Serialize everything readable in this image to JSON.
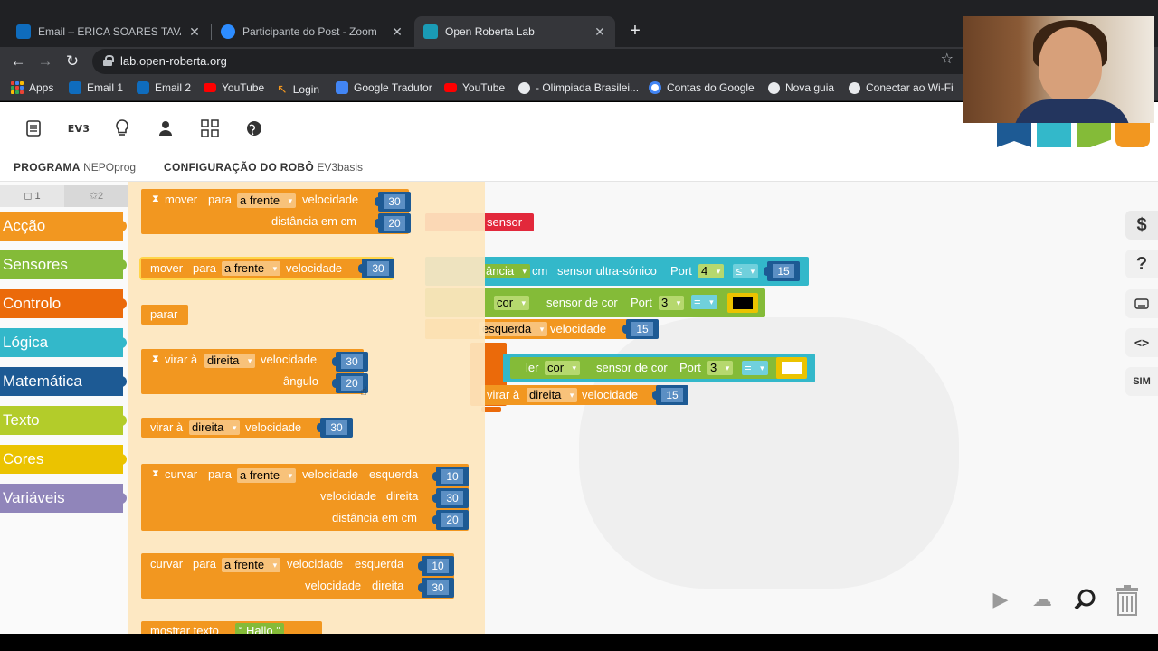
{
  "browser": {
    "tabs": [
      {
        "label": "Email – ERICA SOARES TAVARES",
        "favicon": "outlook-icon",
        "color": "#0f6cbd",
        "active": false
      },
      {
        "label": "Participante do Post - Zoom",
        "favicon": "zoom-icon",
        "color": "#2d8cff",
        "active": false
      },
      {
        "label": "Open Roberta Lab",
        "favicon": "roberta-icon",
        "color": "#1a9bb5",
        "active": true
      }
    ],
    "url": "lab.open-roberta.org",
    "bookmarks": [
      {
        "label": "Apps",
        "icon": "apps-grid-icon"
      },
      {
        "label": "Email 1",
        "icon": "outlook-icon"
      },
      {
        "label": "Email 2",
        "icon": "outlook-icon"
      },
      {
        "label": "YouTube",
        "icon": "youtube-icon"
      },
      {
        "label": "Login",
        "icon": "login-icon"
      },
      {
        "label": "Google Tradutor",
        "icon": "translate-icon"
      },
      {
        "label": "YouTube",
        "icon": "youtube-icon"
      },
      {
        "label": "- Olimpiada Brasilei...",
        "icon": "globe-icon"
      },
      {
        "label": "Contas do Google",
        "icon": "google-icon"
      },
      {
        "label": "Nova guia",
        "icon": "globe-icon"
      },
      {
        "label": "Conectar ao Wi-Fi",
        "icon": "globe-icon"
      }
    ]
  },
  "app": {
    "menu": {
      "ev3_label": "EV3",
      "icons": [
        "document-icon",
        "ev3-robot-icon",
        "lightbulb-icon",
        "user-icon",
        "gallery-icon",
        "globe-icon"
      ],
      "logo_colors": [
        "#1d5a94",
        "#33b8ca",
        "#84bb38",
        "#f29720"
      ]
    },
    "tabs": {
      "program_label": "PROGRAMA",
      "program_name": "NEPOprog",
      "config_label": "CONFIGURAÇÃO DO ROBÔ",
      "config_name": "EV3basis"
    },
    "levels": {
      "beginner": "1",
      "expert": "2"
    },
    "categories": [
      {
        "label": "Acção",
        "color": "#f29720"
      },
      {
        "label": "Sensores",
        "color": "#84bb38"
      },
      {
        "label": "Controlo",
        "color": "#eb6a0a"
      },
      {
        "label": "Lógica",
        "color": "#33b8ca"
      },
      {
        "label": "Matemática",
        "color": "#1d5a94"
      },
      {
        "label": "Texto",
        "color": "#b3cc2a"
      },
      {
        "label": "Cores",
        "color": "#ebc300"
      },
      {
        "label": "Variáveis",
        "color": "#9085ba"
      }
    ],
    "flyout": {
      "b1": {
        "kw": "mover",
        "para": "para",
        "dir": "a frente",
        "vel": "velocidade",
        "v": "30",
        "dist": "distância em cm",
        "d": "20"
      },
      "b2": {
        "kw": "mover",
        "para": "para",
        "dir": "a frente",
        "vel": "velocidade",
        "v": "30"
      },
      "b3": {
        "kw": "parar"
      },
      "b4": {
        "kw": "virar à",
        "dir": "direita",
        "vel": "velocidade",
        "v": "30",
        "ang": "ângulo",
        "a": "20"
      },
      "b5": {
        "kw": "virar à",
        "dir": "direita",
        "vel": "velocidade",
        "v": "30"
      },
      "b6": {
        "kw": "curvar",
        "para": "para",
        "dir": "a frente",
        "vel": "velocidade",
        "left": "esquerda",
        "vl": "10",
        "vel2": "velocidade",
        "right": "direita",
        "vr": "30",
        "dist": "distância em cm",
        "d": "20"
      },
      "b7": {
        "kw": "curvar",
        "para": "para",
        "dir": "a frente",
        "vel": "velocidade",
        "left": "esquerda",
        "vl": "10",
        "vel2": "velocidade",
        "right": "direita",
        "vr": "30"
      },
      "b8": {
        "kw": "mostrar texto",
        "text": "Hallo"
      }
    },
    "canvas": {
      "sensor": "sensor",
      "c1": {
        "drop": "ância",
        "unit": "cm",
        "sensor": "sensor ultra-sónico",
        "port": "Port",
        "port_val": "4",
        "op": "≤",
        "val": "15"
      },
      "c2": {
        "drop": "cor",
        "sensor": "sensor de cor",
        "port": "Port",
        "port_val": "3",
        "op": "=",
        "color": "#000000"
      },
      "c3": {
        "drop": "esquerda",
        "vel": "velocidade",
        "val": "15"
      },
      "c4": {
        "kw": "ler",
        "drop": "cor",
        "sensor": "sensor de cor",
        "port": "Port",
        "port_val": "3",
        "op": "=",
        "color": "#ffffff"
      },
      "c5": {
        "kw": "virar à",
        "drop": "direita",
        "vel": "velocidade",
        "val": "15"
      }
    },
    "rail": {
      "code_label": "<>",
      "sim_label": "SIM"
    }
  }
}
